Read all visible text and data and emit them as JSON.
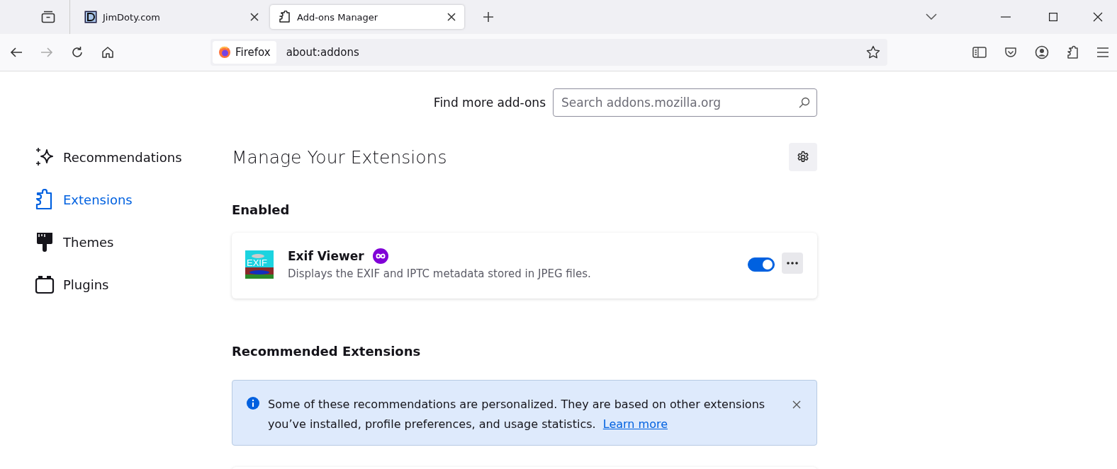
{
  "tabs": [
    {
      "title": "JimDoty.com",
      "kind": "site",
      "selected": false
    },
    {
      "title": "Add-ons Manager",
      "kind": "addons",
      "selected": true
    }
  ],
  "address_bar": {
    "identity": "Firefox",
    "url": "about:addons"
  },
  "find_more": {
    "label": "Find more add-ons",
    "placeholder": "Search addons.mozilla.org"
  },
  "sidebar": {
    "items": [
      {
        "label": "Recommendations",
        "kind": "recommendations",
        "selected": false
      },
      {
        "label": "Extensions",
        "kind": "extensions",
        "selected": true
      },
      {
        "label": "Themes",
        "kind": "themes",
        "selected": false
      },
      {
        "label": "Plugins",
        "kind": "plugins",
        "selected": false
      }
    ]
  },
  "heading": "Manage Your Extensions",
  "enabled_section": {
    "title": "Enabled",
    "extensions": [
      {
        "name": "Exif Viewer",
        "logo_text": "EXIF",
        "description": "Displays the EXIF and IPTC metadata stored in JPEG files.",
        "private_browsing": true,
        "enabled": true
      }
    ]
  },
  "recommended_section": {
    "title": "Recommended Extensions",
    "message": "Some of these recommendations are personalized. They are based on other extensions you’ve installed, profile preferences, and usage statistics.",
    "link": "Learn more"
  }
}
